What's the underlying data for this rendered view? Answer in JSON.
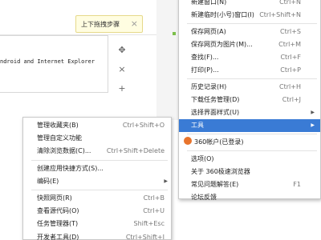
{
  "page": {
    "content_text": "ndroid and Internet Explorer"
  },
  "tooltip": {
    "label": "上下拖拽步骤",
    "close": "×"
  },
  "tools": {
    "move_glyph": "✥",
    "close_glyph": "×",
    "add_glyph": "+"
  },
  "main_menu": {
    "items": [
      {
        "label": "新建窗口(N)",
        "shortcut": "Ctrl+N"
      },
      {
        "label": "新建临时(小号)窗口(I)",
        "shortcut": "Ctrl+Shift+N"
      },
      {
        "label": "保存网页(A)",
        "shortcut": "Ctrl+S"
      },
      {
        "label": "保存网页为图片(M)...",
        "shortcut": "Ctrl+M"
      },
      {
        "label": "查找(F)...",
        "shortcut": "Ctrl+F"
      },
      {
        "label": "打印(P)...",
        "shortcut": "Ctrl+P"
      },
      {
        "label": "历史记录(H)",
        "shortcut": "Ctrl+H"
      },
      {
        "label": "下载任务管理(D)",
        "shortcut": "Ctrl+J"
      },
      {
        "label": "选择界面样式(U)",
        "shortcut": ""
      },
      {
        "label": "工具",
        "shortcut": ""
      },
      {
        "label": "360帐户(已登录)",
        "shortcut": ""
      },
      {
        "label": "选项(O)",
        "shortcut": ""
      },
      {
        "label": "关于 360极速浏览器",
        "shortcut": ""
      },
      {
        "label": "常见问题解答(E)",
        "shortcut": "F1"
      },
      {
        "label": "论坛反馈",
        "shortcut": ""
      }
    ]
  },
  "sub_menu": {
    "items": [
      {
        "label": "管理收藏夹(B)",
        "shortcut": "Ctrl+Shift+O"
      },
      {
        "label": "管理自定义功能",
        "shortcut": ""
      },
      {
        "label": "清除浏览数据(C)...",
        "shortcut": "Ctrl+Shift+Delete"
      },
      {
        "label": "创建应用快捷方式(S)...",
        "shortcut": ""
      },
      {
        "label": "编码(E)",
        "shortcut": ""
      },
      {
        "label": "快照网页(R)",
        "shortcut": "Ctrl+B"
      },
      {
        "label": "查看源代码(O)",
        "shortcut": "Ctrl+U"
      },
      {
        "label": "任务管理器(T)",
        "shortcut": "Shift+Esc"
      },
      {
        "label": "开发者工具(D)",
        "shortcut": "Ctrl+Shift+I"
      }
    ]
  },
  "icons": {
    "submenu_arrow": "▶"
  },
  "colors": {
    "highlight": "#3a7bd5",
    "tooltip_bg": "#fffde1",
    "account_icon": "#e8742c"
  }
}
